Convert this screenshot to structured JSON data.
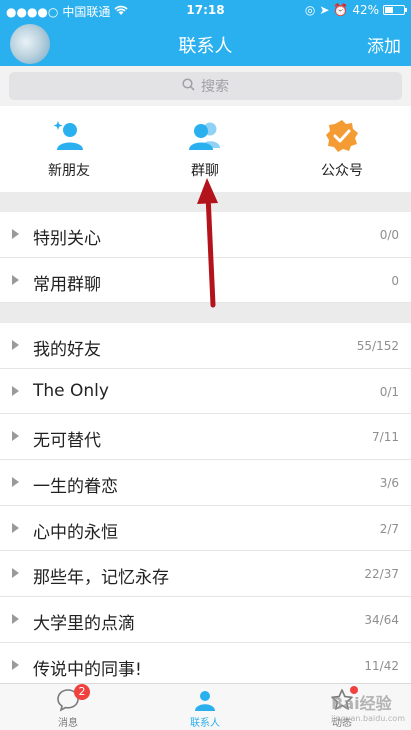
{
  "status": {
    "carrier": "中国联通",
    "time": "17:18",
    "battery": "42%",
    "battery_level": 0.42
  },
  "navbar": {
    "title": "联系人",
    "add_label": "添加"
  },
  "search": {
    "placeholder": "搜索"
  },
  "quick_actions": [
    {
      "label": "新朋友",
      "icon": "new-friend-icon"
    },
    {
      "label": "群聊",
      "icon": "group-chat-icon"
    },
    {
      "label": "公众号",
      "icon": "official-account-icon"
    }
  ],
  "groups_top": [
    {
      "name": "特别关心",
      "count": "0/0"
    },
    {
      "name": "常用群聊",
      "count": "0"
    }
  ],
  "groups_main": [
    {
      "name": "我的好友",
      "count": "55/152"
    },
    {
      "name": "The Only",
      "count": "0/1"
    },
    {
      "name": "无可替代",
      "count": "7/11"
    },
    {
      "name": "一生的眷恋",
      "count": "3/6"
    },
    {
      "name": "心中的永恒",
      "count": "2/7"
    },
    {
      "name": "那些年，记忆永存",
      "count": "22/37"
    },
    {
      "name": "大学里的点滴",
      "count": "34/64"
    },
    {
      "name": "传说中的同事!",
      "count": "11/42"
    }
  ],
  "tabs": [
    {
      "label": "消息",
      "badge": "2",
      "icon": "message-icon"
    },
    {
      "label": "联系人",
      "icon": "contacts-icon"
    },
    {
      "label": "动态",
      "icon": "star-icon"
    }
  ],
  "watermark": {
    "text": "Bai经验",
    "sub": "jingyan.baidu.com"
  },
  "colors": {
    "brand": "#2bb0ef",
    "badge": "#f0413e",
    "accent_orange": "#f59b33"
  }
}
